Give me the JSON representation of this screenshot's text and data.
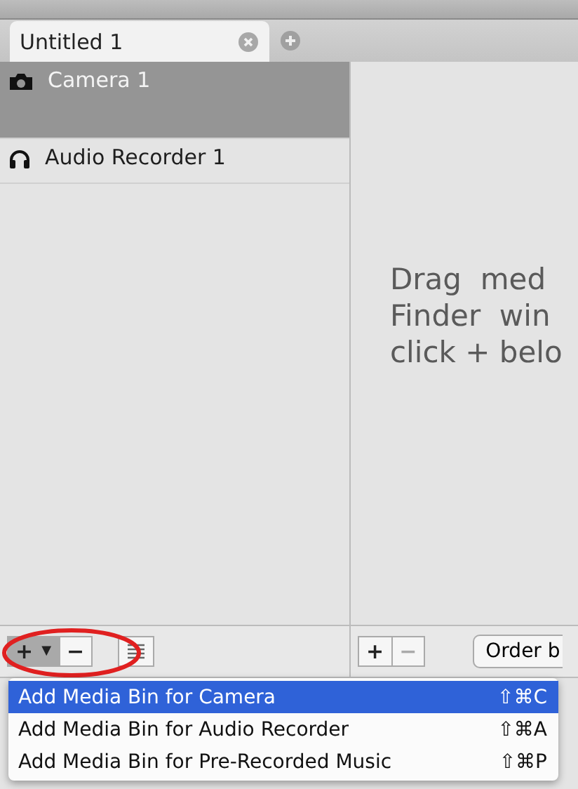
{
  "tabs": [
    {
      "label": "Untitled 1",
      "selected": true,
      "closable": true
    }
  ],
  "bins": [
    {
      "name": "Camera 1",
      "kind": "camera",
      "selected": true
    },
    {
      "name": "Audio Recorder 1",
      "kind": "audio",
      "selected": false
    }
  ],
  "drop_hint": [
    "Drag  med",
    "Finder  win",
    "click + belo"
  ],
  "left_toolbar": {
    "add": "+",
    "add_caret": "▼",
    "remove": "−",
    "highlighted": true
  },
  "right_toolbar": {
    "add": "+",
    "remove": "−",
    "remove_disabled": true,
    "order": "Order b"
  },
  "menu": [
    {
      "label": "Add Media Bin for Camera",
      "shortcut": "⇧⌘C",
      "selected": true
    },
    {
      "label": "Add Media Bin for Audio Recorder",
      "shortcut": "⇧⌘A",
      "selected": false
    },
    {
      "label": "Add Media Bin for Pre-Recorded Music",
      "shortcut": "⇧⌘P",
      "selected": false
    }
  ]
}
